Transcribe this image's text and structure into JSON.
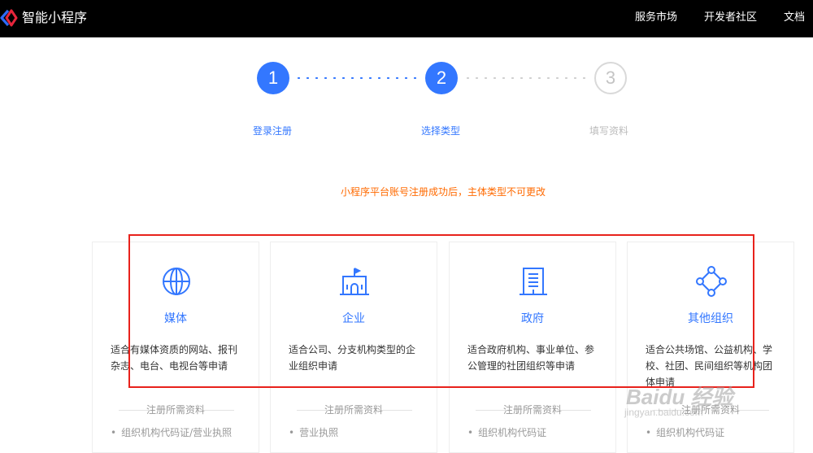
{
  "header": {
    "brand": "智能小程序",
    "nav": [
      "服务市场",
      "开发者社区",
      "文档"
    ]
  },
  "steps": [
    {
      "number": "1",
      "label": "登录注册",
      "state": "done"
    },
    {
      "number": "2",
      "label": "选择类型",
      "state": "current"
    },
    {
      "number": "3",
      "label": "填写资料",
      "state": "pending"
    }
  ],
  "notice": "小程序平台账号注册成功后，主体类型不可更改",
  "cards": [
    {
      "icon": "globe-icon",
      "title": "媒体",
      "desc": "适合有媒体资质的网站、报刊杂志、电台、电视台等申请",
      "req_header": "注册所需资料",
      "req_item": "组织机构代码证/营业执照"
    },
    {
      "icon": "building-flag-icon",
      "title": "企业",
      "desc": "适合公司、分支机构类型的企业组织申请",
      "req_header": "注册所需资料",
      "req_item": "营业执照"
    },
    {
      "icon": "government-building-icon",
      "title": "政府",
      "desc": "适合政府机构、事业单位、参公管理的社团组织等申请",
      "req_header": "注册所需资料",
      "req_item": "组织机构代码证"
    },
    {
      "icon": "network-nodes-icon",
      "title": "其他组织",
      "desc": "适合公共场馆、公益机构、学校、社团、民间组织等机构团体申请",
      "req_header": "注册所需资料",
      "req_item": "组织机构代码证"
    }
  ],
  "watermark": {
    "text": "Baidu 经验",
    "url": "jingyan.baidu.com"
  },
  "colors": {
    "accent": "#3377ff",
    "notice": "#ff6a00",
    "highlight": "#e8221c"
  }
}
